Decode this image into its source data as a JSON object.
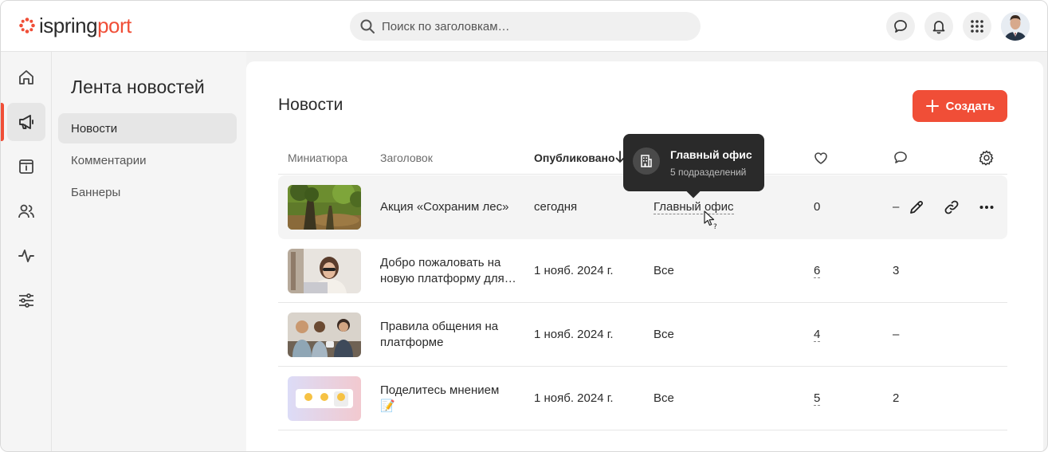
{
  "app": {
    "logo_part1": "ispring",
    "logo_part2": "port"
  },
  "search": {
    "placeholder": "Поиск по заголовкам…"
  },
  "sidebar": {
    "title": "Лента новостей",
    "items": [
      {
        "label": "Новости",
        "active": true
      },
      {
        "label": "Комментарии",
        "active": false
      },
      {
        "label": "Баннеры",
        "active": false
      }
    ]
  },
  "main": {
    "title": "Новости",
    "create_label": "Создать",
    "columns": {
      "thumb": "Миниатюра",
      "title": "Заголовок",
      "published": "Опубликовано"
    },
    "rows": [
      {
        "title": "Акция «Сохраним лес»",
        "date": "сегодня",
        "audience": "Главный офис",
        "likes": "0",
        "comments": "–"
      },
      {
        "title_line1": "Добро пожаловать на",
        "title_line2": "новую платформу для…",
        "date": "1 нояб. 2024 г.",
        "audience": "Все",
        "likes": "6",
        "comments": "3"
      },
      {
        "title_line1": "Правила общения на",
        "title_line2": "платформе",
        "date": "1 нояб. 2024 г.",
        "audience": "Все",
        "likes": "4",
        "comments": "–"
      },
      {
        "title_line1": "Поделитесь мнением",
        "title_line2": "📝",
        "date": "1 нояб. 2024 г.",
        "audience": "Все",
        "likes": "5",
        "comments": "2"
      }
    ]
  },
  "tooltip": {
    "title": "Главный офис",
    "subtitle": "5 подразделений"
  },
  "colors": {
    "accent": "#f04e37",
    "tooltip_bg": "#2a2a2a"
  }
}
